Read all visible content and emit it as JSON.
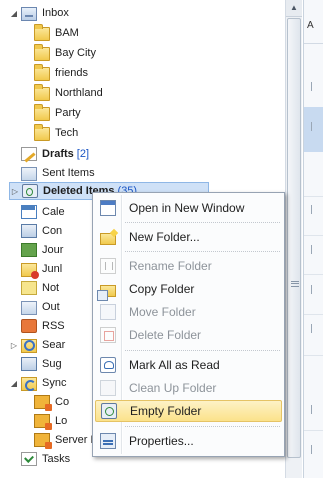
{
  "folder_tree": {
    "inbox": {
      "label": "Inbox"
    },
    "subfolders": [
      "BAM",
      "Bay City",
      "friends",
      "Northland",
      "Party",
      "Tech"
    ],
    "drafts": {
      "label": "Drafts",
      "count": "[2]"
    },
    "sent": {
      "label": "Sent Items"
    },
    "deleted": {
      "label": "Deleted Items",
      "count": "(35)"
    },
    "calendar": {
      "label": "Cale"
    },
    "contacts": {
      "label": "Con"
    },
    "journal": {
      "label": "Jour"
    },
    "junk": {
      "label": "Junl"
    },
    "notes": {
      "label": "Not"
    },
    "outbox": {
      "label": "Out"
    },
    "rss": {
      "label": "RSS"
    },
    "search": {
      "label": "Sear"
    },
    "suggested": {
      "label": "Sug"
    },
    "sync": {
      "label": "Sync"
    },
    "conflicts": {
      "label": "Co"
    },
    "local": {
      "label": "Lo"
    },
    "server_failures": {
      "label": "Server Failures"
    },
    "tasks": {
      "label": "Tasks"
    }
  },
  "context_menu": {
    "open_new_window": "Open in New Window",
    "new_folder": "New Folder...",
    "rename_folder": "Rename Folder",
    "copy_folder": "Copy Folder",
    "move_folder": "Move Folder",
    "delete_folder": "Delete Folder",
    "mark_all_read": "Mark All as Read",
    "clean_up_folder": "Clean Up Folder",
    "empty_folder": "Empty Folder",
    "properties": "Properties..."
  },
  "right_strip": {
    "header_glyph": "A"
  },
  "colors": {
    "selection": "#cfe1f7",
    "highlight": "#fbe28a",
    "count": "#1a55c4"
  }
}
